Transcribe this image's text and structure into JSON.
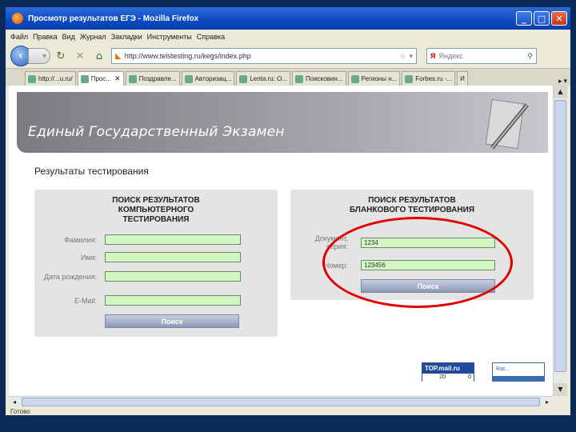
{
  "window": {
    "title": "Просмотр результатов ЕГЭ - Mozilla Firefox",
    "buttons": {
      "minimize": "_",
      "maximize": "□",
      "close": "✕"
    }
  },
  "menu": [
    "Файл",
    "Правка",
    "Вид",
    "Журнал",
    "Закладки",
    "Инструменты",
    "Справка"
  ],
  "navigation": {
    "url": "http://www.telstesting.ru/kegs/index.php",
    "search_placeholder": "Яндекс",
    "search_engine_label": "Я"
  },
  "tabs": [
    {
      "label": "http://...u.ru/",
      "active": false
    },
    {
      "label": "Прос...",
      "active": true
    },
    {
      "label": "Поздравле...",
      "active": false
    },
    {
      "label": "Авторизац...",
      "active": false
    },
    {
      "label": "Lenta.ru: О...",
      "active": false
    },
    {
      "label": "Поисковин...",
      "active": false
    },
    {
      "label": "Регионы н...",
      "active": false
    },
    {
      "label": "Forbes.ru -...",
      "active": false
    },
    {
      "label": "И",
      "active": false
    }
  ],
  "page": {
    "banner_title": "Единый Государственный Экзамен",
    "section_title": "Результаты тестирования",
    "computer_search": {
      "heading": "ПОИСК РЕЗУЛЬТАТОВ КОМПЬЮТЕРНОГО ТЕСТИРОВАНИЯ",
      "fields": {
        "surname_label": "Фамилия:",
        "name_label": "Имя:",
        "birth_label": "Дата рождения:",
        "email_label": "E-Mail:"
      },
      "button": "Поиск"
    },
    "blank_search": {
      "heading": "ПОИСК РЕЗУЛЬТАТОВ БЛАНКОВОГО ТЕСТИРОВАНИЯ",
      "fields": {
        "doc_series_label": "Документ, серия:",
        "doc_series_value": "1234",
        "number_label": "Номер:",
        "number_value": "123456"
      },
      "button": "Поиск"
    },
    "counter": {
      "title": "TOP.mail.ru",
      "value_a": "20",
      "value_b": "0"
    },
    "liveinternet": "Rat..."
  },
  "status": "Готово",
  "colors": {
    "field_bg": "#d3f7c2",
    "highlight": "#e00000",
    "titlebar": "#0a4bc2"
  }
}
